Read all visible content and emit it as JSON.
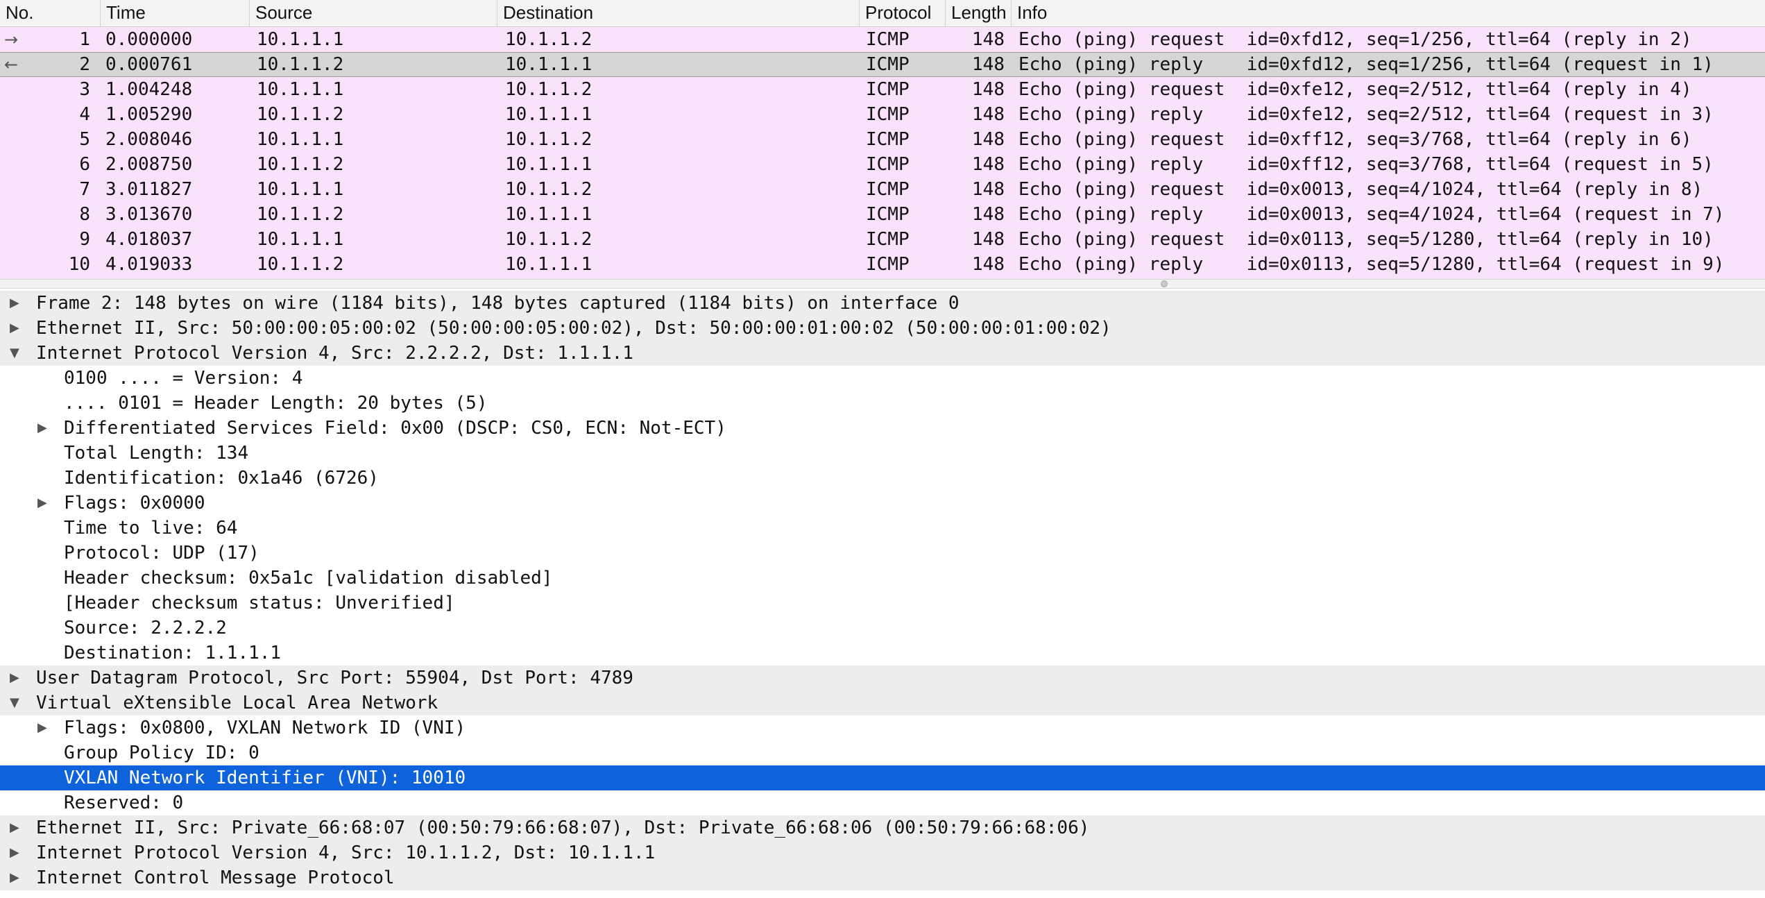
{
  "columns": [
    "No.",
    "Time",
    "Source",
    "Destination",
    "Protocol",
    "Length",
    "Info"
  ],
  "packets": [
    {
      "no": "1",
      "time": "0.000000",
      "source": "10.1.1.1",
      "destination": "10.1.1.2",
      "protocol": "ICMP",
      "length": "148",
      "info": "Echo (ping) request  id=0xfd12, seq=1/256, ttl=64 (reply in 2)",
      "marker": "→"
    },
    {
      "no": "2",
      "time": "0.000761",
      "source": "10.1.1.2",
      "destination": "10.1.1.1",
      "protocol": "ICMP",
      "length": "148",
      "info": "Echo (ping) reply    id=0xfd12, seq=1/256, ttl=64 (request in 1)",
      "marker": "←"
    },
    {
      "no": "3",
      "time": "1.004248",
      "source": "10.1.1.1",
      "destination": "10.1.1.2",
      "protocol": "ICMP",
      "length": "148",
      "info": "Echo (ping) request  id=0xfe12, seq=2/512, ttl=64 (reply in 4)",
      "marker": ""
    },
    {
      "no": "4",
      "time": "1.005290",
      "source": "10.1.1.2",
      "destination": "10.1.1.1",
      "protocol": "ICMP",
      "length": "148",
      "info": "Echo (ping) reply    id=0xfe12, seq=2/512, ttl=64 (request in 3)",
      "marker": ""
    },
    {
      "no": "5",
      "time": "2.008046",
      "source": "10.1.1.1",
      "destination": "10.1.1.2",
      "protocol": "ICMP",
      "length": "148",
      "info": "Echo (ping) request  id=0xff12, seq=3/768, ttl=64 (reply in 6)",
      "marker": ""
    },
    {
      "no": "6",
      "time": "2.008750",
      "source": "10.1.1.2",
      "destination": "10.1.1.1",
      "protocol": "ICMP",
      "length": "148",
      "info": "Echo (ping) reply    id=0xff12, seq=3/768, ttl=64 (request in 5)",
      "marker": ""
    },
    {
      "no": "7",
      "time": "3.011827",
      "source": "10.1.1.1",
      "destination": "10.1.1.2",
      "protocol": "ICMP",
      "length": "148",
      "info": "Echo (ping) request  id=0x0013, seq=4/1024, ttl=64 (reply in 8)",
      "marker": ""
    },
    {
      "no": "8",
      "time": "3.013670",
      "source": "10.1.1.2",
      "destination": "10.1.1.1",
      "protocol": "ICMP",
      "length": "148",
      "info": "Echo (ping) reply    id=0x0013, seq=4/1024, ttl=64 (request in 7)",
      "marker": ""
    },
    {
      "no": "9",
      "time": "4.018037",
      "source": "10.1.1.1",
      "destination": "10.1.1.2",
      "protocol": "ICMP",
      "length": "148",
      "info": "Echo (ping) request  id=0x0113, seq=5/1280, ttl=64 (reply in 10)",
      "marker": ""
    },
    {
      "no": "10",
      "time": "4.019033",
      "source": "10.1.1.2",
      "destination": "10.1.1.1",
      "protocol": "ICMP",
      "length": "148",
      "info": "Echo (ping) reply    id=0x0113, seq=5/1280, ttl=64 (request in 9)",
      "marker": ""
    }
  ],
  "selected_packet": "2",
  "details": [
    {
      "level": 0,
      "toggle": "collapsed",
      "text": "Frame 2: 148 bytes on wire (1184 bits), 148 bytes captured (1184 bits) on interface 0"
    },
    {
      "level": 0,
      "toggle": "collapsed",
      "text": "Ethernet II, Src: 50:00:00:05:00:02 (50:00:00:05:00:02), Dst: 50:00:00:01:00:02 (50:00:00:01:00:02)"
    },
    {
      "level": 0,
      "toggle": "expanded",
      "text": "Internet Protocol Version 4, Src: 2.2.2.2, Dst: 1.1.1.1"
    },
    {
      "level": 1,
      "toggle": "none",
      "text": "0100 .... = Version: 4"
    },
    {
      "level": 1,
      "toggle": "none",
      "text": ".... 0101 = Header Length: 20 bytes (5)"
    },
    {
      "level": 1,
      "toggle": "collapsed",
      "text": "Differentiated Services Field: 0x00 (DSCP: CS0, ECN: Not-ECT)"
    },
    {
      "level": 1,
      "toggle": "none",
      "text": "Total Length: 134"
    },
    {
      "level": 1,
      "toggle": "none",
      "text": "Identification: 0x1a46 (6726)"
    },
    {
      "level": 1,
      "toggle": "collapsed",
      "text": "Flags: 0x0000"
    },
    {
      "level": 1,
      "toggle": "none",
      "text": "Time to live: 64"
    },
    {
      "level": 1,
      "toggle": "none",
      "text": "Protocol: UDP (17)"
    },
    {
      "level": 1,
      "toggle": "none",
      "text": "Header checksum: 0x5a1c [validation disabled]"
    },
    {
      "level": 1,
      "toggle": "none",
      "text": "[Header checksum status: Unverified]"
    },
    {
      "level": 1,
      "toggle": "none",
      "text": "Source: 2.2.2.2"
    },
    {
      "level": 1,
      "toggle": "none",
      "text": "Destination: 1.1.1.1"
    },
    {
      "level": 0,
      "toggle": "collapsed",
      "text": "User Datagram Protocol, Src Port: 55904, Dst Port: 4789"
    },
    {
      "level": 0,
      "toggle": "expanded",
      "text": "Virtual eXtensible Local Area Network"
    },
    {
      "level": 1,
      "toggle": "collapsed",
      "text": "Flags: 0x0800, VXLAN Network ID (VNI)"
    },
    {
      "level": 1,
      "toggle": "none",
      "text": "Group Policy ID: 0"
    },
    {
      "level": 1,
      "toggle": "none",
      "text": "VXLAN Network Identifier (VNI): 10010",
      "highlighted": true
    },
    {
      "level": 1,
      "toggle": "none",
      "text": "Reserved: 0"
    },
    {
      "level": 0,
      "toggle": "collapsed",
      "text": "Ethernet II, Src: Private_66:68:07 (00:50:79:66:68:07), Dst: Private_66:68:06 (00:50:79:66:68:06)"
    },
    {
      "level": 0,
      "toggle": "collapsed",
      "text": "Internet Protocol Version 4, Src: 10.1.1.2, Dst: 10.1.1.1"
    },
    {
      "level": 0,
      "toggle": "collapsed",
      "text": "Internet Control Message Protocol"
    }
  ],
  "icons": {
    "collapsed": "▶",
    "expanded": "▼"
  },
  "colors": {
    "icmp_row": "#fbe2fb",
    "selected_row": "#d6d6d6",
    "highlight": "#0e63dc"
  }
}
